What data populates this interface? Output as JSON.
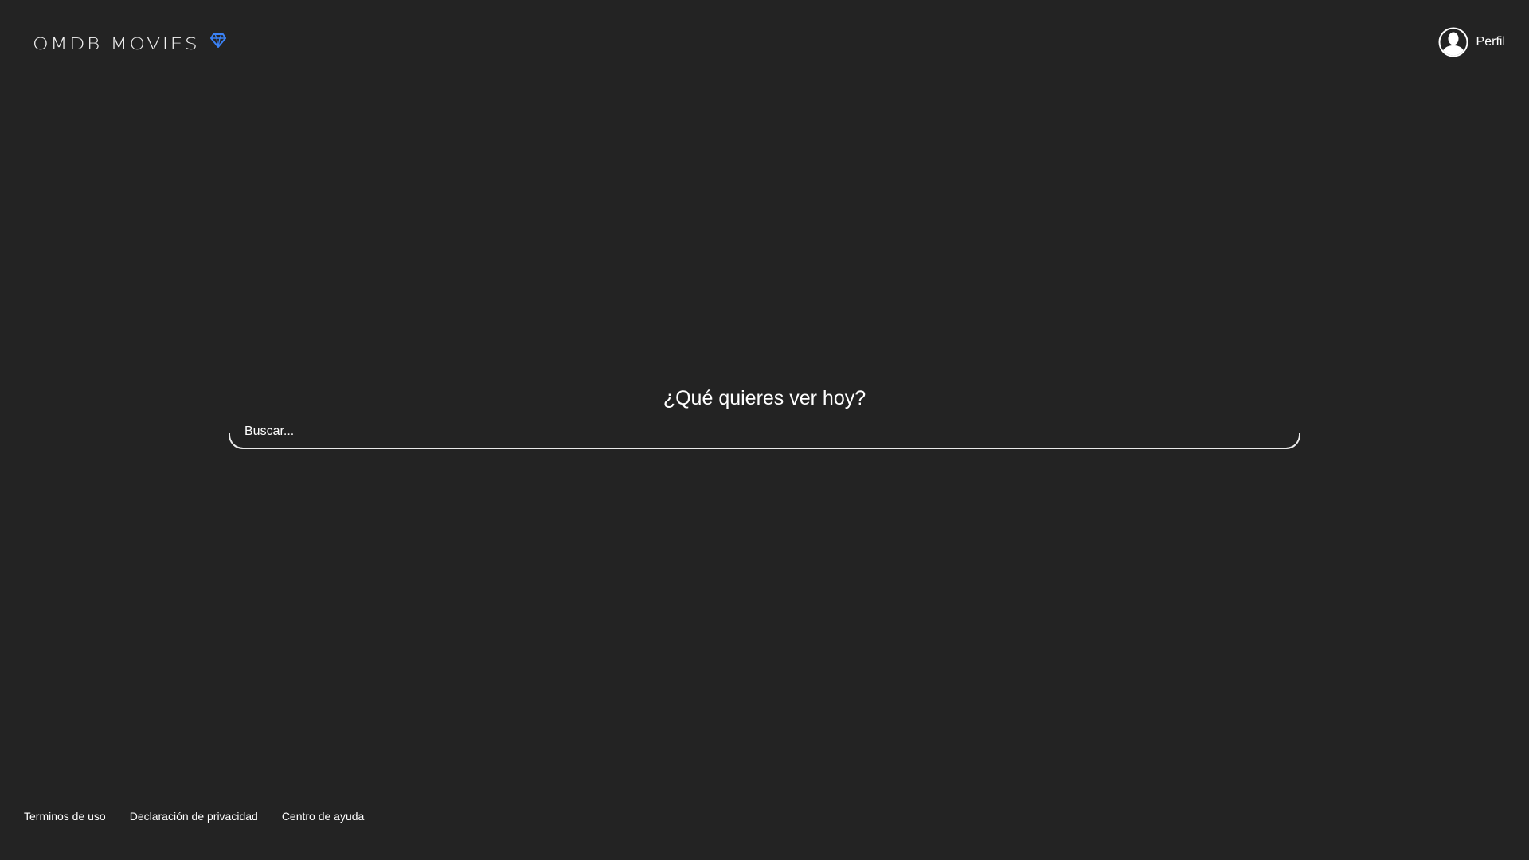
{
  "header": {
    "logo_text": "omdb movies",
    "logo_icon": "diamond-icon",
    "logo_icon_color": "#3b82f6",
    "profile_label": "Perfil",
    "profile_icon": "user-avatar-icon"
  },
  "main": {
    "headline": "¿Qué quieres ver hoy?",
    "search": {
      "placeholder": "Buscar...",
      "value": ""
    }
  },
  "footer": {
    "links": [
      {
        "label": "Terminos de uso"
      },
      {
        "label": "Declaración de privacidad"
      },
      {
        "label": "Centro de ayuda"
      }
    ]
  },
  "colors": {
    "background": "#232323",
    "text": "#ffffff",
    "accent": "#3b82f6"
  }
}
